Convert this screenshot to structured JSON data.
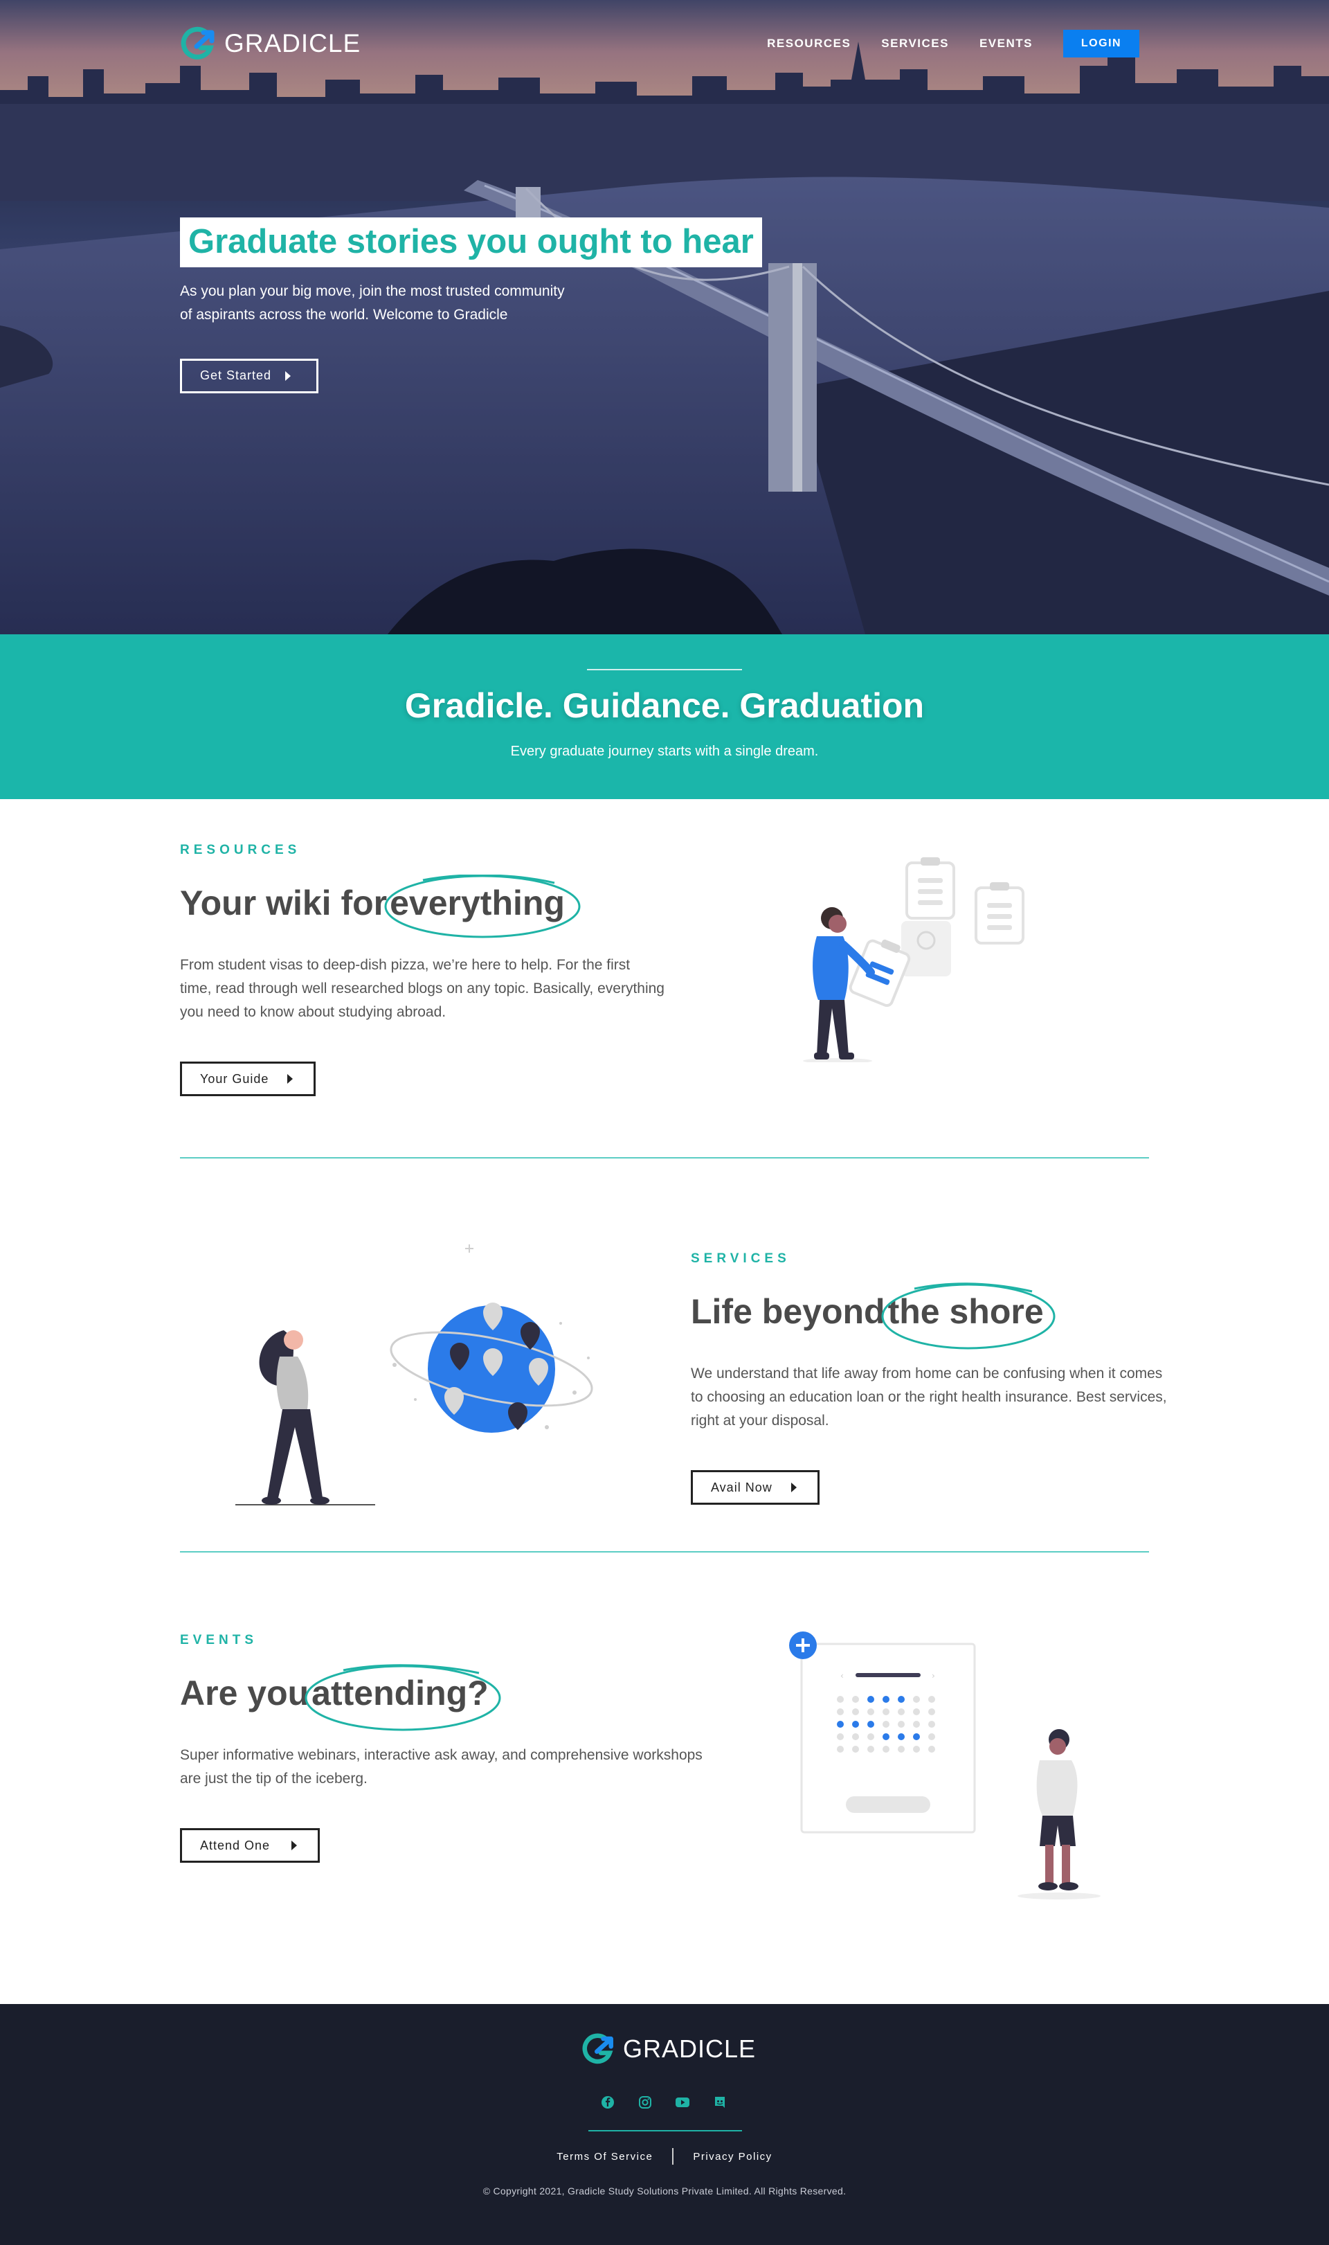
{
  "nav": {
    "brand": "GRADICLE",
    "links": [
      "RESOURCES",
      "SERVICES",
      "EVENTS"
    ],
    "login": "LOGIN"
  },
  "hero": {
    "title": "Graduate stories you ought to hear",
    "subtitle_line1": "As you plan your big move, join the most trusted community",
    "subtitle_line2": "of aspirants across the world. Welcome to Gradicle",
    "cta": "Get Started"
  },
  "banner": {
    "title": "Gradicle. Guidance. Graduation",
    "subtitle": "Every graduate journey starts with a single dream."
  },
  "resources": {
    "kicker": "RESOURCES",
    "heading_plain": "Your wiki for",
    "heading_circled": "everything",
    "body": "From student visas to deep-dish pizza, we’re here to help. For the first time, read through well researched blogs on any topic. Basically, everything you need to know about studying abroad.",
    "cta": "Your Guide"
  },
  "services": {
    "kicker": "SERVICES",
    "heading_plain": "Life beyond",
    "heading_circled": "the shore",
    "body": "We understand that life away from home can be confusing when it comes to choosing an education loan or the right health insurance. Best services, right at your disposal.",
    "cta": "Avail Now"
  },
  "events": {
    "kicker": "EVENTS",
    "heading_plain": "Are you",
    "heading_circled": "attending?",
    "body": "Super informative webinars, interactive ask away, and comprehensive workshops are just the tip of the iceberg.",
    "cta": "Attend One"
  },
  "footer": {
    "brand": "GRADICLE",
    "social_icons": [
      "facebook-icon",
      "instagram-icon",
      "youtube-icon",
      "discord-icon"
    ],
    "terms": "Terms Of Service",
    "privacy": "Privacy Policy",
    "copyright": "© Copyright 2021, Gradicle Study Solutions Private Limited. All Rights Reserved."
  },
  "colors": {
    "accent": "#1bb6aa",
    "login_blue": "#0a7ff0",
    "footer_bg": "#1a1e2c",
    "illustration_blue": "#2b7be9"
  }
}
